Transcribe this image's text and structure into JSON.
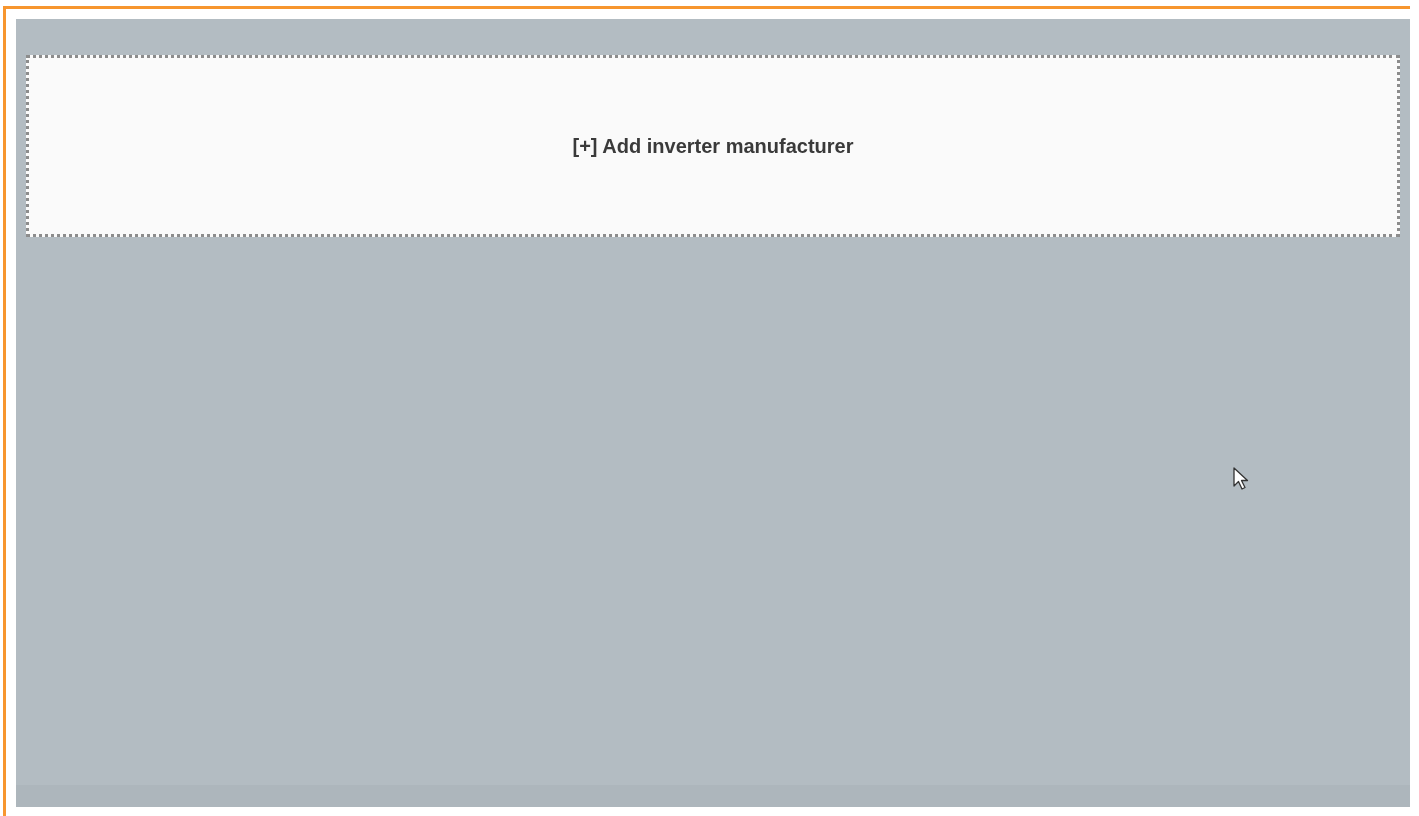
{
  "add_button": {
    "label": "[+] Add inverter manufacturer"
  }
}
